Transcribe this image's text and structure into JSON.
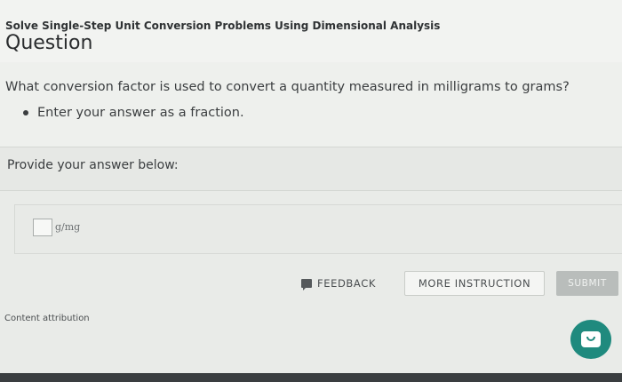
{
  "header": {
    "lesson_title": "Solve Single-Step Unit Conversion Problems Using Dimensional Analysis",
    "section_title": "Question"
  },
  "question": {
    "text": "What conversion factor is used to convert a quantity measured in milligrams to grams?",
    "bullet": "Enter your answer as a fraction."
  },
  "answer": {
    "prompt": "Provide your answer below:",
    "input_value": "",
    "unit": "g/mg"
  },
  "actions": {
    "feedback_label": "FEEDBACK",
    "more_instruction_label": "MORE INSTRUCTION",
    "submit_label": "SUBMIT"
  },
  "footer": {
    "attribution": "Content attribution"
  },
  "colors": {
    "chat_button": "#1f8a7e",
    "submit_disabled": "#b9bdbb"
  }
}
